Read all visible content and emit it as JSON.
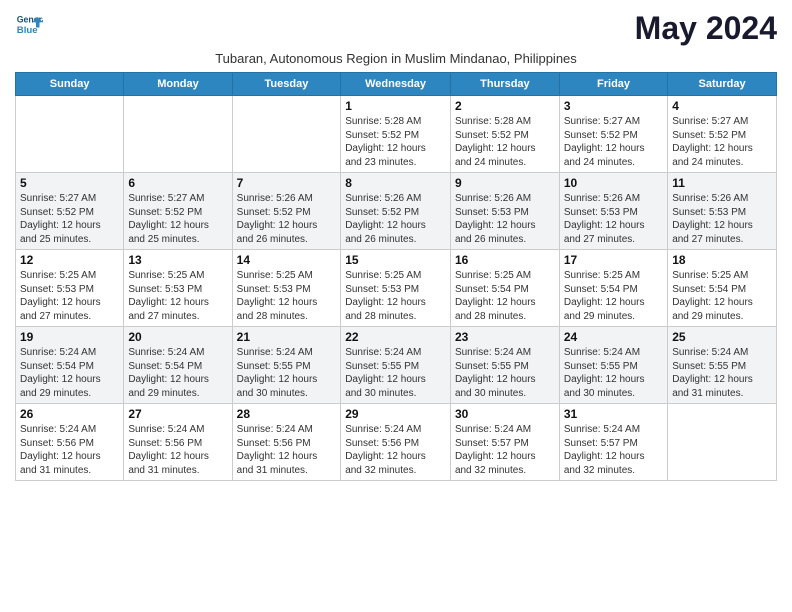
{
  "logo": {
    "line1": "General",
    "line2": "Blue"
  },
  "title": "May 2024",
  "subtitle": "Tubaran, Autonomous Region in Muslim Mindanao, Philippines",
  "days_of_week": [
    "Sunday",
    "Monday",
    "Tuesday",
    "Wednesday",
    "Thursday",
    "Friday",
    "Saturday"
  ],
  "weeks": [
    [
      {
        "day": "",
        "info": ""
      },
      {
        "day": "",
        "info": ""
      },
      {
        "day": "",
        "info": ""
      },
      {
        "day": "1",
        "info": "Sunrise: 5:28 AM\nSunset: 5:52 PM\nDaylight: 12 hours\nand 23 minutes."
      },
      {
        "day": "2",
        "info": "Sunrise: 5:28 AM\nSunset: 5:52 PM\nDaylight: 12 hours\nand 24 minutes."
      },
      {
        "day": "3",
        "info": "Sunrise: 5:27 AM\nSunset: 5:52 PM\nDaylight: 12 hours\nand 24 minutes."
      },
      {
        "day": "4",
        "info": "Sunrise: 5:27 AM\nSunset: 5:52 PM\nDaylight: 12 hours\nand 24 minutes."
      }
    ],
    [
      {
        "day": "5",
        "info": "Sunrise: 5:27 AM\nSunset: 5:52 PM\nDaylight: 12 hours\nand 25 minutes."
      },
      {
        "day": "6",
        "info": "Sunrise: 5:27 AM\nSunset: 5:52 PM\nDaylight: 12 hours\nand 25 minutes."
      },
      {
        "day": "7",
        "info": "Sunrise: 5:26 AM\nSunset: 5:52 PM\nDaylight: 12 hours\nand 26 minutes."
      },
      {
        "day": "8",
        "info": "Sunrise: 5:26 AM\nSunset: 5:52 PM\nDaylight: 12 hours\nand 26 minutes."
      },
      {
        "day": "9",
        "info": "Sunrise: 5:26 AM\nSunset: 5:53 PM\nDaylight: 12 hours\nand 26 minutes."
      },
      {
        "day": "10",
        "info": "Sunrise: 5:26 AM\nSunset: 5:53 PM\nDaylight: 12 hours\nand 27 minutes."
      },
      {
        "day": "11",
        "info": "Sunrise: 5:26 AM\nSunset: 5:53 PM\nDaylight: 12 hours\nand 27 minutes."
      }
    ],
    [
      {
        "day": "12",
        "info": "Sunrise: 5:25 AM\nSunset: 5:53 PM\nDaylight: 12 hours\nand 27 minutes."
      },
      {
        "day": "13",
        "info": "Sunrise: 5:25 AM\nSunset: 5:53 PM\nDaylight: 12 hours\nand 27 minutes."
      },
      {
        "day": "14",
        "info": "Sunrise: 5:25 AM\nSunset: 5:53 PM\nDaylight: 12 hours\nand 28 minutes."
      },
      {
        "day": "15",
        "info": "Sunrise: 5:25 AM\nSunset: 5:53 PM\nDaylight: 12 hours\nand 28 minutes."
      },
      {
        "day": "16",
        "info": "Sunrise: 5:25 AM\nSunset: 5:54 PM\nDaylight: 12 hours\nand 28 minutes."
      },
      {
        "day": "17",
        "info": "Sunrise: 5:25 AM\nSunset: 5:54 PM\nDaylight: 12 hours\nand 29 minutes."
      },
      {
        "day": "18",
        "info": "Sunrise: 5:25 AM\nSunset: 5:54 PM\nDaylight: 12 hours\nand 29 minutes."
      }
    ],
    [
      {
        "day": "19",
        "info": "Sunrise: 5:24 AM\nSunset: 5:54 PM\nDaylight: 12 hours\nand 29 minutes."
      },
      {
        "day": "20",
        "info": "Sunrise: 5:24 AM\nSunset: 5:54 PM\nDaylight: 12 hours\nand 29 minutes."
      },
      {
        "day": "21",
        "info": "Sunrise: 5:24 AM\nSunset: 5:55 PM\nDaylight: 12 hours\nand 30 minutes."
      },
      {
        "day": "22",
        "info": "Sunrise: 5:24 AM\nSunset: 5:55 PM\nDaylight: 12 hours\nand 30 minutes."
      },
      {
        "day": "23",
        "info": "Sunrise: 5:24 AM\nSunset: 5:55 PM\nDaylight: 12 hours\nand 30 minutes."
      },
      {
        "day": "24",
        "info": "Sunrise: 5:24 AM\nSunset: 5:55 PM\nDaylight: 12 hours\nand 30 minutes."
      },
      {
        "day": "25",
        "info": "Sunrise: 5:24 AM\nSunset: 5:55 PM\nDaylight: 12 hours\nand 31 minutes."
      }
    ],
    [
      {
        "day": "26",
        "info": "Sunrise: 5:24 AM\nSunset: 5:56 PM\nDaylight: 12 hours\nand 31 minutes."
      },
      {
        "day": "27",
        "info": "Sunrise: 5:24 AM\nSunset: 5:56 PM\nDaylight: 12 hours\nand 31 minutes."
      },
      {
        "day": "28",
        "info": "Sunrise: 5:24 AM\nSunset: 5:56 PM\nDaylight: 12 hours\nand 31 minutes."
      },
      {
        "day": "29",
        "info": "Sunrise: 5:24 AM\nSunset: 5:56 PM\nDaylight: 12 hours\nand 32 minutes."
      },
      {
        "day": "30",
        "info": "Sunrise: 5:24 AM\nSunset: 5:57 PM\nDaylight: 12 hours\nand 32 minutes."
      },
      {
        "day": "31",
        "info": "Sunrise: 5:24 AM\nSunset: 5:57 PM\nDaylight: 12 hours\nand 32 minutes."
      },
      {
        "day": "",
        "info": ""
      }
    ]
  ]
}
